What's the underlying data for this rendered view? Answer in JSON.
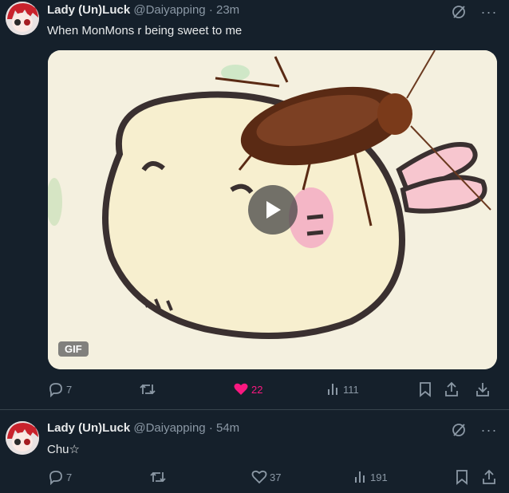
{
  "colors": {
    "background": "#15202b",
    "text": "#e7e9ea",
    "secondary": "#8b98a5",
    "like_active": "#f91880",
    "divider": "#38444d"
  },
  "tweets": [
    {
      "author_name": "Lady (Un)Luck",
      "handle": "@Daiyapping",
      "separator": "·",
      "time": "23m",
      "text": "When MonMons r being sweet to me",
      "media": {
        "badge": "GIF"
      },
      "replies": "7",
      "retweets": "",
      "likes": "22",
      "liked": true,
      "views": "111",
      "icons": [
        "grok-icon",
        "more-icon",
        "reply-icon",
        "retweet-icon",
        "heart-icon",
        "views-icon",
        "bookmark-icon",
        "share-icon",
        "download-icon"
      ]
    },
    {
      "author_name": "Lady (Un)Luck",
      "handle": "@Daiyapping",
      "separator": "·",
      "time": "54m",
      "text": "Chu☆",
      "replies": "7",
      "retweets": "",
      "likes": "37",
      "liked": false,
      "views": "191",
      "icons": [
        "grok-icon",
        "more-icon",
        "reply-icon",
        "retweet-icon",
        "heart-icon",
        "views-icon",
        "bookmark-icon",
        "share-icon"
      ]
    }
  ]
}
